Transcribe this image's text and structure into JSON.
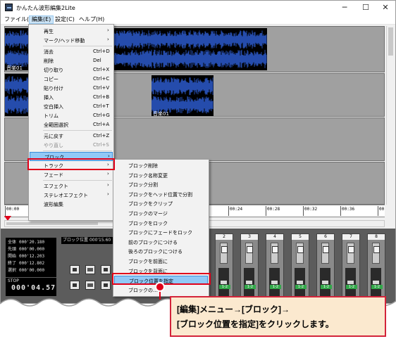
{
  "window": {
    "title": "かんたん波形編集2Lite",
    "minimize": "─",
    "maximize": "☐",
    "close": "✕"
  },
  "menubar": {
    "file": "ファイル(F)",
    "edit": "編集(E)",
    "settings": "設定(C)",
    "help": "ヘルプ(H)"
  },
  "tracks": {
    "clip1_label": "音楽01",
    "clip2_label": "音楽01"
  },
  "ruler": {
    "ticks": [
      "00:00",
      "00:24",
      "00:28",
      "00:32",
      "00:36",
      "00"
    ]
  },
  "info_panel": {
    "rows": [
      {
        "label": "全体",
        "value": "000'20.180"
      },
      {
        "label": "先頭",
        "value": "000'00.000"
      },
      {
        "label": "開始",
        "value": "000'12.203"
      },
      {
        "label": "終了",
        "value": "000'12.802"
      },
      {
        "label": "選択",
        "value": "000'00.000"
      }
    ],
    "block_position_label": "ブロック位置",
    "block_position_value": "000'15.60",
    "status": "STOP",
    "time": "000'04.57"
  },
  "mixer": {
    "channels": [
      "2",
      "3",
      "4",
      "5",
      "6",
      "7",
      "8"
    ],
    "pan_labels": [
      "1-2",
      "1-2",
      "1-2",
      "1-2",
      "1-2",
      "1-2",
      "1-2"
    ]
  },
  "edit_menu": {
    "items": [
      {
        "label": "再生",
        "shortcut": "",
        "submenu": true,
        "disabled": false
      },
      {
        "label": "マーク/ヘッド移動",
        "shortcut": "",
        "submenu": true,
        "disabled": false
      },
      {
        "label": "消去",
        "shortcut": "Ctrl+D",
        "submenu": false,
        "disabled": false
      },
      {
        "label": "削除",
        "shortcut": "Del",
        "submenu": false,
        "disabled": false
      },
      {
        "label": "切り取り",
        "shortcut": "Ctrl+X",
        "submenu": false,
        "disabled": false
      },
      {
        "label": "コピー",
        "shortcut": "Ctrl+C",
        "submenu": false,
        "disabled": false
      },
      {
        "label": "貼り付け",
        "shortcut": "Ctrl+V",
        "submenu": false,
        "disabled": false
      },
      {
        "label": "挿入",
        "shortcut": "Ctrl+B",
        "submenu": false,
        "disabled": false
      },
      {
        "label": "空白挿入",
        "shortcut": "Ctrl+T",
        "submenu": false,
        "disabled": false
      },
      {
        "label": "トリム",
        "shortcut": "Ctrl+G",
        "submenu": false,
        "disabled": false
      },
      {
        "label": "全範囲選択",
        "shortcut": "Ctrl+A",
        "submenu": false,
        "disabled": false
      },
      {
        "label": "元に戻す",
        "shortcut": "Ctrl+Z",
        "submenu": false,
        "disabled": false
      },
      {
        "label": "やり直し",
        "shortcut": "Ctrl+S",
        "submenu": false,
        "disabled": true
      },
      {
        "label": "ブロック",
        "shortcut": "",
        "submenu": true,
        "disabled": false,
        "highlighted": true
      },
      {
        "label": "トラック",
        "shortcut": "",
        "submenu": true,
        "disabled": false
      },
      {
        "label": "フェード",
        "shortcut": "",
        "submenu": true,
        "disabled": false
      },
      {
        "label": "エフェクト",
        "shortcut": "",
        "submenu": true,
        "disabled": false
      },
      {
        "label": "ステレオエフェクト",
        "shortcut": "",
        "submenu": true,
        "disabled": false
      },
      {
        "label": "波形編集",
        "shortcut": "",
        "submenu": false,
        "disabled": false
      }
    ],
    "arrow": "›"
  },
  "block_menu": {
    "items": [
      {
        "label": "ブロック削除"
      },
      {
        "label": "ブロック名称変更"
      },
      {
        "label": "ブロック分割"
      },
      {
        "label": "ブロックをヘッド位置で分割"
      },
      {
        "label": "ブロックをクリップ"
      },
      {
        "label": "ブロックのマージ"
      },
      {
        "label": "ブロックをロック"
      },
      {
        "label": "ブロックにフェードをロック"
      },
      {
        "label": "前のブロックにつける"
      },
      {
        "label": "後ろのブロックにつける"
      },
      {
        "label": "ブロックを前面に"
      },
      {
        "label": "ブロックを背面に"
      },
      {
        "label": "ブロック位置を指定",
        "highlighted": true
      },
      {
        "label": "ブロックの…"
      }
    ]
  },
  "callout": {
    "line1": "[編集]メニュー→[ブロック]→",
    "line2": "[ブロック位置を指定]をクリックします。"
  },
  "colors": {
    "accent_red": "#e0001a",
    "wave_blue": "#2f5fd8",
    "menu_highlight": "#91c9f7",
    "callout_bg": "#fbe9cf"
  }
}
